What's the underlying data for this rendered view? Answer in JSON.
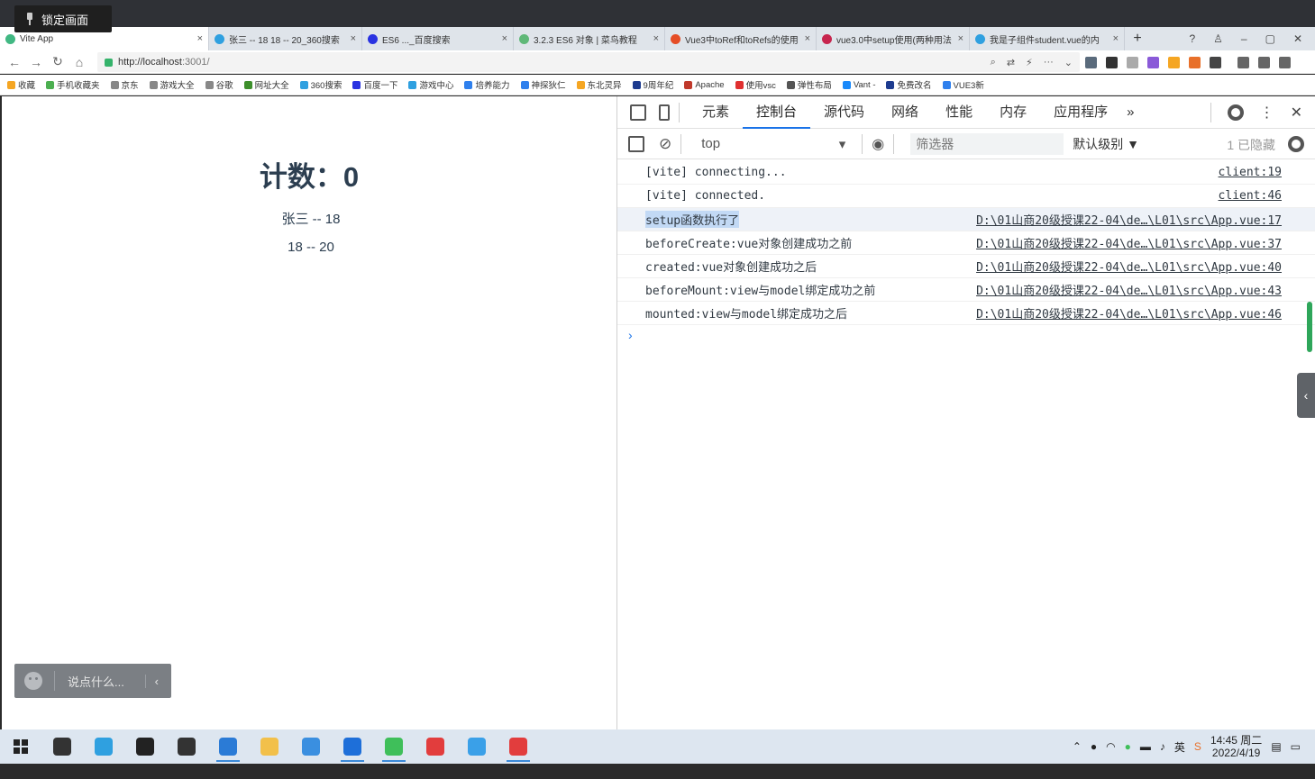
{
  "overlay": {
    "lock_label": "锁定画面"
  },
  "tabs": [
    {
      "label": "Vite App",
      "color": "#41b883",
      "active": true
    },
    {
      "label": "张三 -- 18 18 -- 20_360搜索",
      "color": "#2fa0e0"
    },
    {
      "label": "ES6 ..._百度搜索",
      "color": "#2932e1"
    },
    {
      "label": "3.2.3 ES6 对象 | 菜鸟教程",
      "color": "#5fb878"
    },
    {
      "label": "Vue3中toRef和toRefs的使用",
      "color": "#e54d26"
    },
    {
      "label": "vue3.0中setup使用(两种用法",
      "color": "#c7254e"
    },
    {
      "label": "我是子组件student.vue的内",
      "color": "#2fa0e0"
    }
  ],
  "address": {
    "scheme": "http://",
    "host": "localhost",
    "rest": ":3001/"
  },
  "bookmarks": [
    {
      "label": "收藏",
      "color": "#f5a623"
    },
    {
      "label": "手机收藏夹",
      "color": "#4caf50"
    },
    {
      "label": "京东",
      "color": "#888888"
    },
    {
      "label": "游戏大全",
      "color": "#888888"
    },
    {
      "label": "谷歌",
      "color": "#888888"
    },
    {
      "label": "网址大全",
      "color": "#3d8f2b"
    },
    {
      "label": "360搜索",
      "color": "#2fa0e0"
    },
    {
      "label": "百度一下",
      "color": "#2932e1"
    },
    {
      "label": "游戏中心",
      "color": "#2fa0e0"
    },
    {
      "label": "培养能力",
      "color": "#2f80ed"
    },
    {
      "label": "神探狄仁",
      "color": "#2f80ed"
    },
    {
      "label": "东北灵异",
      "color": "#f5a623"
    },
    {
      "label": "9周年纪",
      "color": "#1d3b8f"
    },
    {
      "label": "Apache",
      "color": "#c0392b"
    },
    {
      "label": "使用vsc",
      "color": "#e03030"
    },
    {
      "label": "弹性布局",
      "color": "#555555"
    },
    {
      "label": "Vant -",
      "color": "#1989fa"
    },
    {
      "label": "免费改名",
      "color": "#1d3b8f"
    },
    {
      "label": "VUE3新",
      "color": "#2f80ed"
    }
  ],
  "page": {
    "count_title": "计数：0",
    "line1": "张三 -- 18",
    "line2": "18 -- 20",
    "chat_placeholder": "说点什么..."
  },
  "devtools": {
    "tabs": [
      "元素",
      "控制台",
      "源代码",
      "网络",
      "性能",
      "内存",
      "应用程序"
    ],
    "active_tab": "控制台",
    "context": "top",
    "filter_placeholder": "筛选器",
    "levels": "默认级别 ▼",
    "hidden_count": "1 已隐藏",
    "logs": [
      {
        "msg": "[vite] connecting...",
        "src": "client:19"
      },
      {
        "msg": "[vite] connected.",
        "src": "client:46"
      },
      {
        "msg": "setup函数执行了",
        "src": "D:\\01山商20级授课22-04\\de…\\L01\\src\\App.vue:17"
      },
      {
        "msg": "beforeCreate:vue对象创建成功之前",
        "src": "D:\\01山商20级授课22-04\\de…\\L01\\src\\App.vue:37"
      },
      {
        "msg": "created:vue对象创建成功之后",
        "src": "D:\\01山商20级授课22-04\\de…\\L01\\src\\App.vue:40"
      },
      {
        "msg": "beforeMount:view与model绑定成功之前",
        "src": "D:\\01山商20级授课22-04\\de…\\L01\\src\\App.vue:43"
      },
      {
        "msg": "mounted:view与model绑定成功之后",
        "src": "D:\\01山商20级授课22-04\\de…\\L01\\src\\App.vue:46"
      }
    ]
  },
  "taskbar": {
    "apps": [
      {
        "name": "search-taskbar-icon",
        "color": "#333333"
      },
      {
        "name": "browser-360-icon",
        "color": "#2fa0e0"
      },
      {
        "name": "cortana-icon",
        "color": "#222222"
      },
      {
        "name": "task-view-icon",
        "color": "#333333"
      },
      {
        "name": "vscode-icon",
        "color": "#2b7bd6",
        "active": true
      },
      {
        "name": "file-explorer-icon",
        "color": "#f2c04a"
      },
      {
        "name": "edge-icon",
        "color": "#3a8fe0"
      },
      {
        "name": "photos-icon",
        "color": "#1e6fd9",
        "active": true
      },
      {
        "name": "browser-se-icon",
        "color": "#3fbf5a",
        "active": true
      },
      {
        "name": "xmind-icon",
        "color": "#e23d3d"
      },
      {
        "name": "qq-icon",
        "color": "#3aa0e8"
      },
      {
        "name": "wps-icon",
        "color": "#e23d3d",
        "active": true
      }
    ],
    "time": "14:45 周二",
    "date": "2022/4/19",
    "ime": "英"
  }
}
